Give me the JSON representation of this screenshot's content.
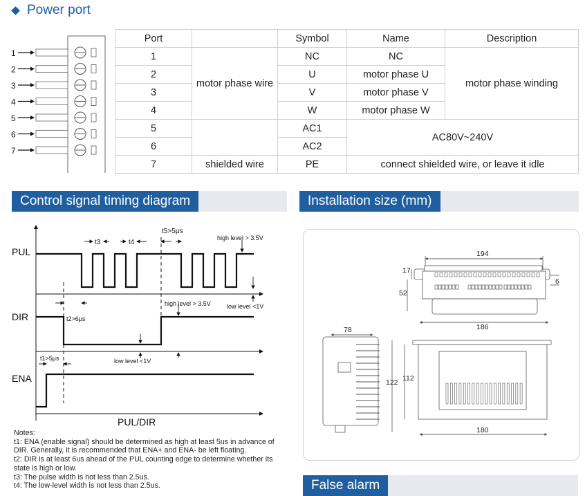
{
  "power_port": {
    "title": "Power port",
    "table": {
      "headers": [
        "Port",
        "Symbol",
        "Name",
        "Description"
      ],
      "rows": [
        {
          "port": "1",
          "symbol": "NC",
          "name": "NC"
        },
        {
          "port": "2",
          "symbol": "U",
          "name": "motor phase U"
        },
        {
          "port": "3",
          "symbol": "V",
          "name": "motor phase V"
        },
        {
          "port": "4",
          "symbol": "W",
          "name": "motor phase W"
        },
        {
          "port": "5",
          "symbol": "AC1"
        },
        {
          "port": "6",
          "symbol": "AC2"
        },
        {
          "port": "7",
          "symbol": "PE"
        }
      ],
      "group_motor": "motor phase wire",
      "group_shield": "shielded wire",
      "desc_winding": "motor phase winding",
      "desc_ac": "AC80V~240V",
      "desc_pe": "connect shielded wire, or leave it idle"
    },
    "pin_labels": [
      "1",
      "2",
      "3",
      "4",
      "5",
      "6",
      "7"
    ]
  },
  "timing": {
    "title": "Control signal timing diagram",
    "signals": [
      "PUL",
      "DIR",
      "ENA"
    ],
    "axis_label": "PUL/DIR",
    "t1": "t1>5μs",
    "t2": "t2>6μs",
    "t3": "t3",
    "t4": "t4",
    "t5": "t5>5μs",
    "pul_high": "high level  > 3.5V",
    "pul_low": "low level  <1V",
    "dir_high": "high level  > 3.5V",
    "dir_low": "low level   <1V",
    "notes": [
      "Notes:",
      "t1: ENA (enable signal) should be determined as high at least 5us in advance of",
      "DIR. Generally, it is recommended that ENA+ and ENA- be left floating.",
      "t2: DIR is at least 6us ahead of the PUL counting edge to determine whether its",
      "state is high or low.",
      "t3: The pulse width is not less than 2.5us.",
      "t4: The low-level width is not less than 2.5us."
    ]
  },
  "installation": {
    "title": "Installation size (mm)",
    "dims": {
      "top_width": "194",
      "mount_width": "186",
      "d17": "17",
      "d52": "52",
      "d6": "6",
      "side_depth": "78",
      "height_total": "122",
      "height_body": "112",
      "bottom_width": "180"
    }
  },
  "false_alarm": {
    "title": "False alarm"
  },
  "colors": {
    "accent": "#1f5f9f",
    "bar_bg": "#e6e9ee",
    "title_blue": "#1a5fa8"
  }
}
